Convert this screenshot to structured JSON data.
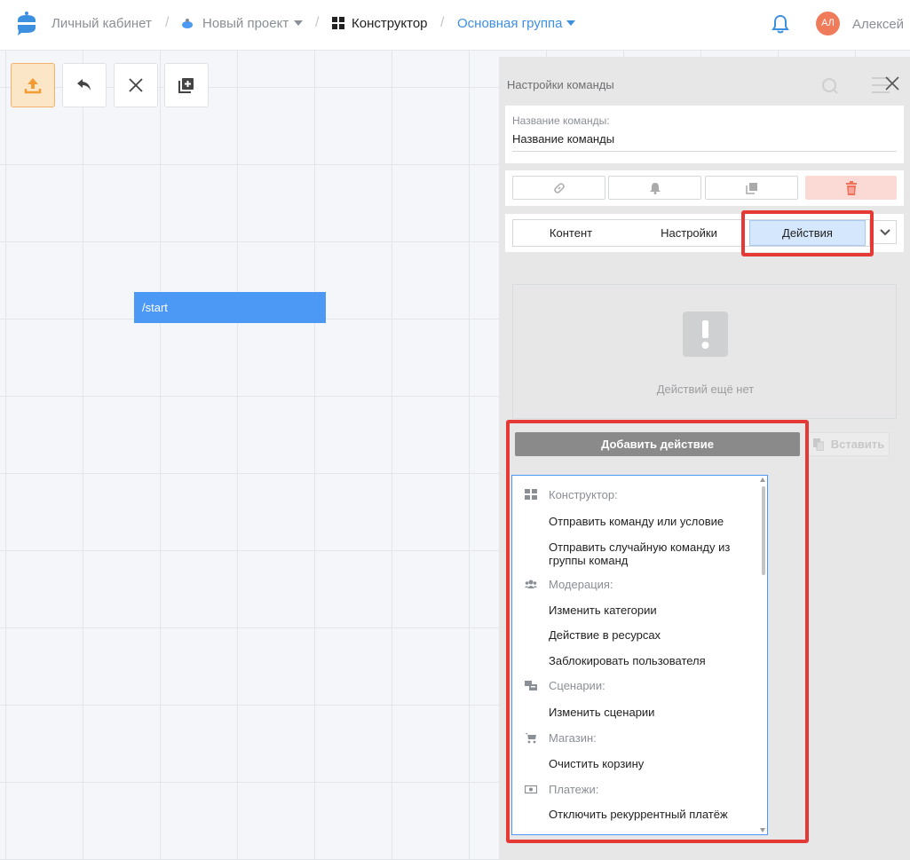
{
  "header": {
    "crumbs": [
      "Личный кабинет",
      "Новый проект",
      "Конструктор",
      "Основная группа"
    ],
    "separator": "/",
    "avatar_initials": "АЛ",
    "username": "Алексей"
  },
  "canvas": {
    "node_label": "/start"
  },
  "panel": {
    "title": "Настройки команды",
    "name_label": "Название команды:",
    "name_value": "Название команды",
    "tabs": [
      "Контент",
      "Настройки",
      "Действия"
    ],
    "active_tab": "Действия",
    "empty_text": "Действий ещё нет",
    "add_action": "Добавить действие",
    "paste": "Вставить"
  },
  "dropdown": {
    "items": [
      {
        "type": "group",
        "icon": "grid-icon",
        "label": "Конструктор:"
      },
      {
        "type": "item",
        "label": "Отправить команду или условие"
      },
      {
        "type": "item",
        "label": "Отправить случайную команду из группы команд"
      },
      {
        "type": "group",
        "icon": "users-icon",
        "label": "Модерация:"
      },
      {
        "type": "item",
        "label": "Изменить категории"
      },
      {
        "type": "item",
        "label": "Действие в ресурсах"
      },
      {
        "type": "item",
        "label": "Заблокировать пользователя"
      },
      {
        "type": "group",
        "icon": "script-icon",
        "label": "Сценарии:"
      },
      {
        "type": "item",
        "label": "Изменить сценарии"
      },
      {
        "type": "group",
        "icon": "cart-icon",
        "label": "Магазин:"
      },
      {
        "type": "item",
        "label": "Очистить корзину"
      },
      {
        "type": "group",
        "icon": "payment-icon",
        "label": "Платежи:"
      },
      {
        "type": "item",
        "label": "Отключить рекуррентный платёж"
      }
    ]
  },
  "colors": {
    "accent": "#4c98f5",
    "highlight": "#e53935",
    "danger_bg": "#fbd9d5",
    "danger_icon": "#f0715a"
  }
}
